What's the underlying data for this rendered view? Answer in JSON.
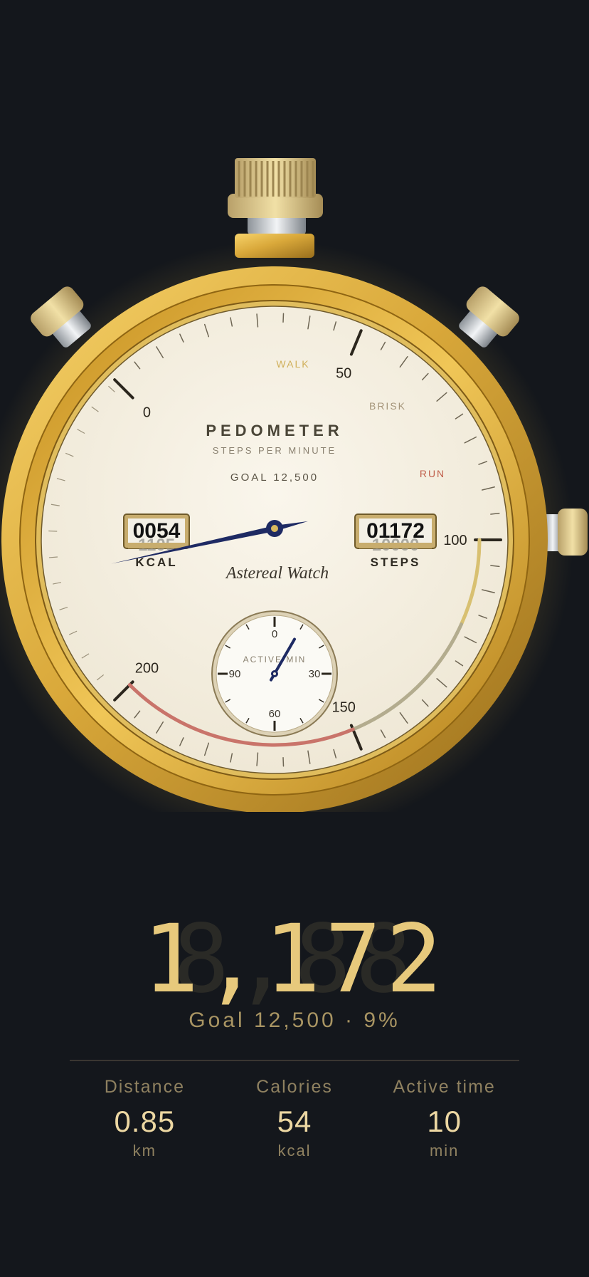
{
  "dial": {
    "title": "PEDOMETER",
    "subtitle": "STEPS PER MINUTE",
    "goal": "GOAL 12,500",
    "brand": "Astereal Watch",
    "scale": [
      "0",
      "50",
      "100",
      "150",
      "200"
    ],
    "zones": [
      "WALK",
      "BRISK",
      "RUN"
    ],
    "needle_value": 91,
    "kcal_counter": "0054",
    "kcal_next": "1105",
    "kcal_label": "KCAL",
    "steps_counter": "01172",
    "steps_next": "10000",
    "steps_label": "STEPS",
    "subdial": {
      "label": "ACTIVE MIN",
      "marks": [
        "0",
        "30",
        "60",
        "90"
      ],
      "value_minutes": 10
    }
  },
  "readout": {
    "digits_lit": "1,172",
    "digits_unlit": "8,88",
    "goal_line": "Goal 12,500  ·  9%"
  },
  "stats": [
    {
      "label": "Distance",
      "value": "0.85",
      "unit": "km"
    },
    {
      "label": "Calories",
      "value": "54",
      "unit": "kcal"
    },
    {
      "label": "Active time",
      "value": "10",
      "unit": "min"
    }
  ],
  "colors": {
    "background": "#14171c",
    "gold": "#d9a83a",
    "dial_face": "#f3eee0",
    "needle": "#1e2a63",
    "walk_zone": "#d8c071",
    "brisk_zone": "#b3ac8e",
    "run_zone": "#c9746a",
    "readout": "#e7c97c"
  }
}
